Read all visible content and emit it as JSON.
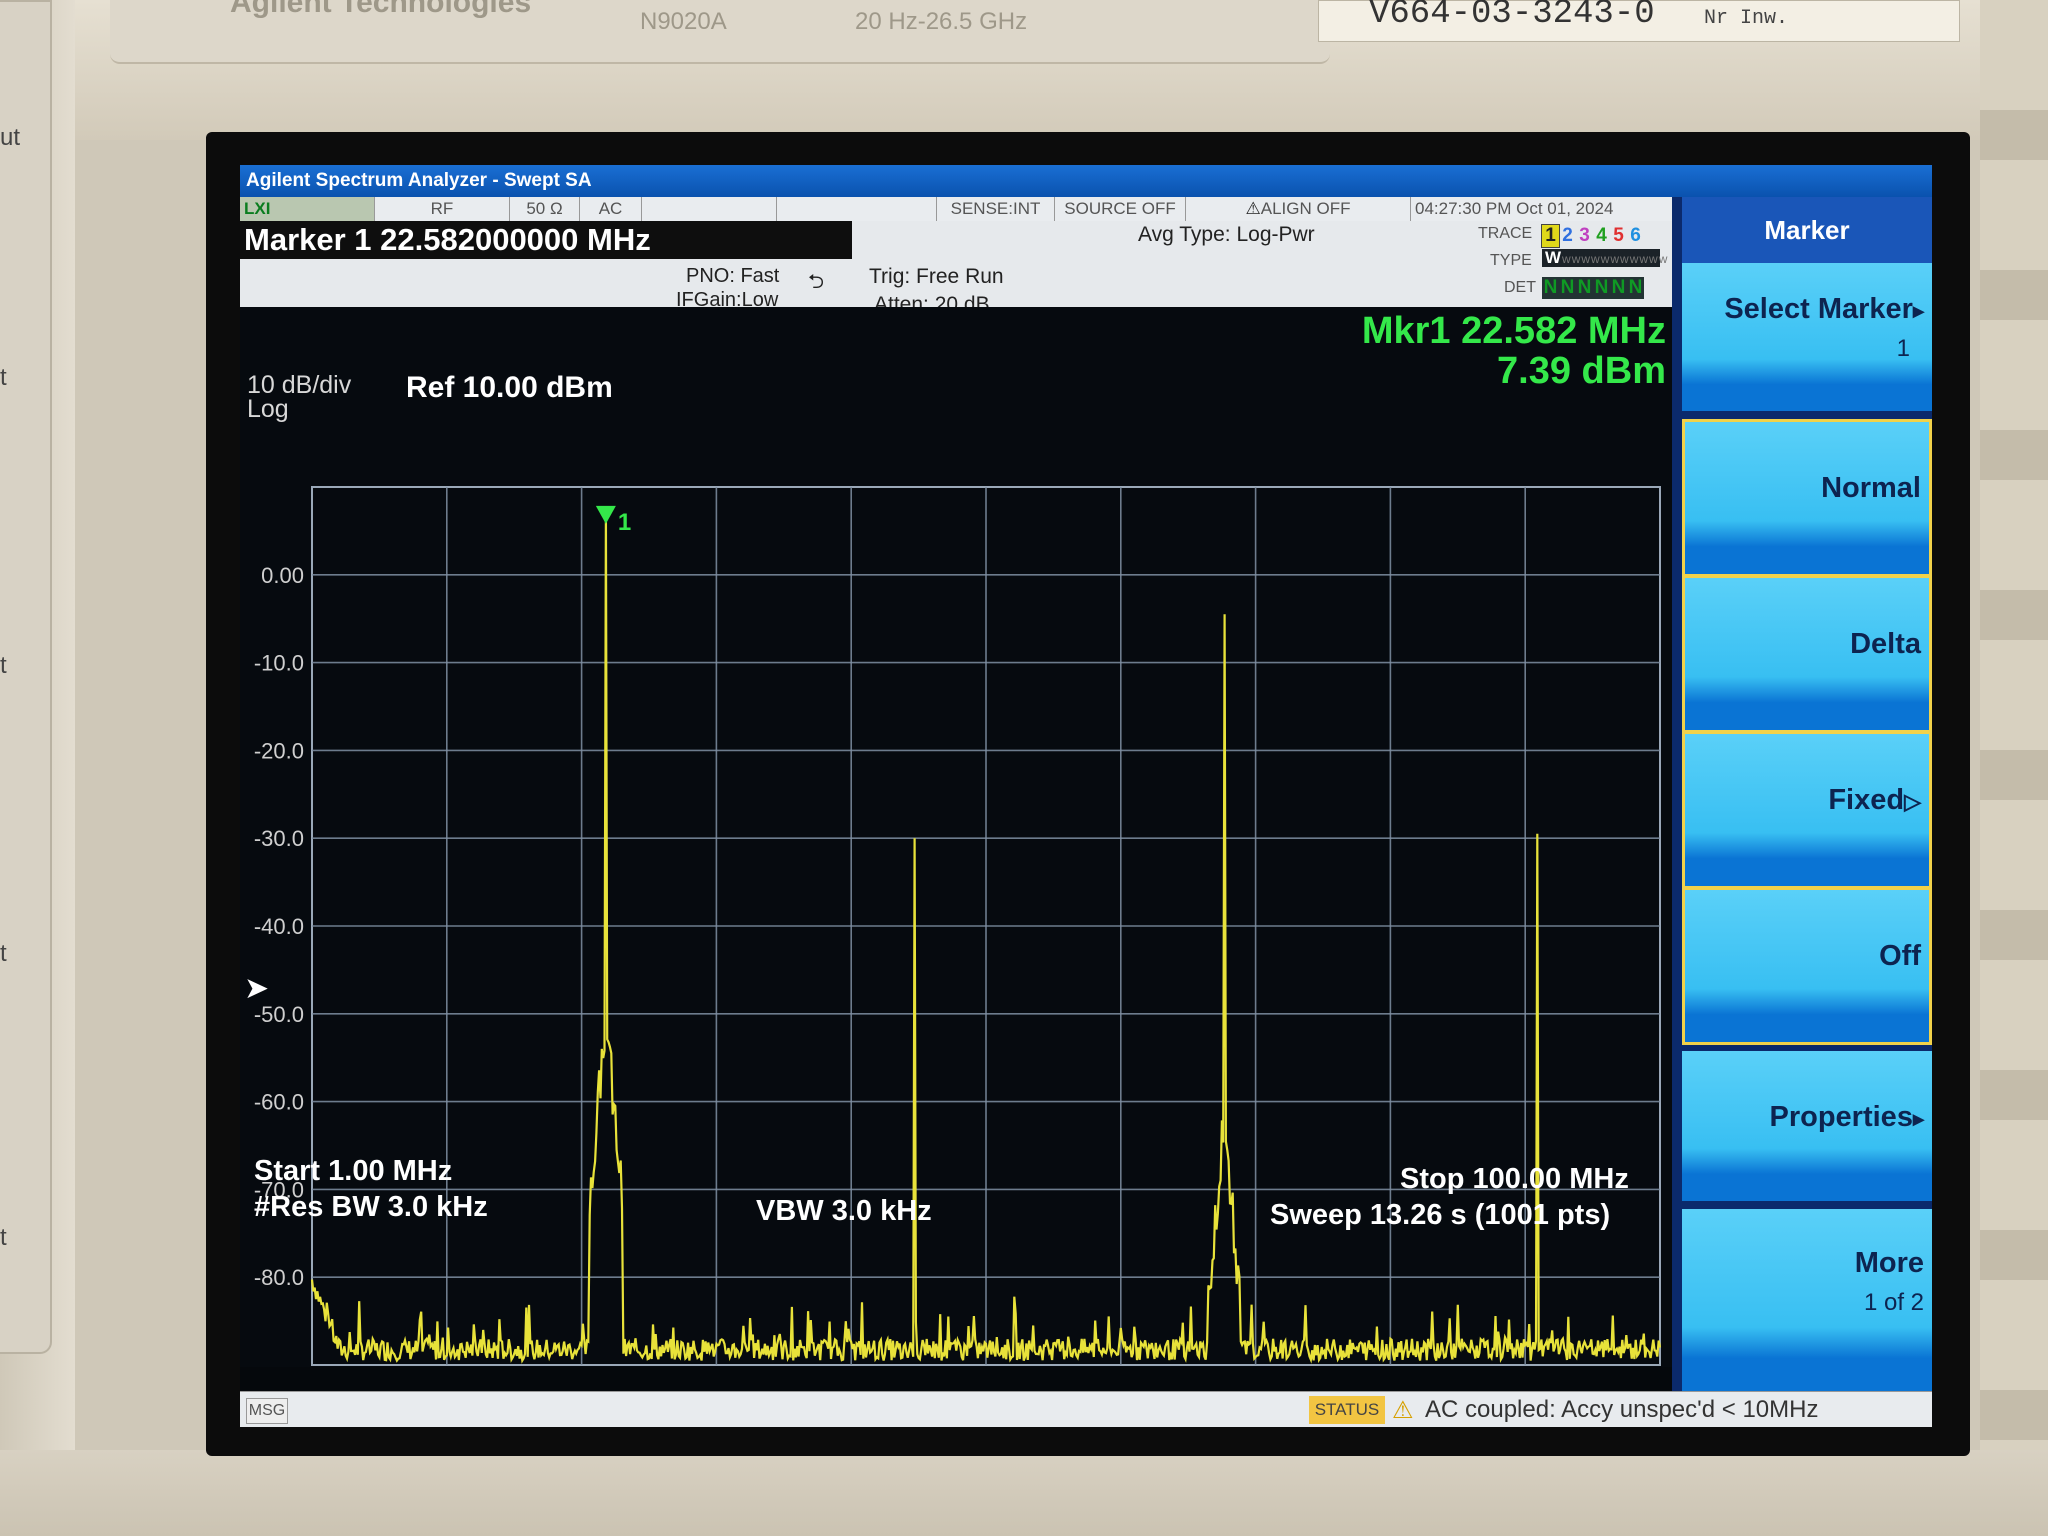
{
  "bezel": {
    "brand": "Agilent Technologies",
    "model": "N9020A",
    "freq_range": "20 Hz-26.5 GHz",
    "serial_label": "V664-03-3243-0",
    "serial_suffix": "Nr Inw.",
    "side_marks": [
      "ut",
      "t",
      "t",
      "t",
      "t"
    ]
  },
  "window": {
    "title": "Agilent Spectrum Analyzer - Swept SA"
  },
  "status_bar": {
    "lxi": "LXI",
    "rf": "RF",
    "impedance": "50 Ω",
    "coupling": "AC",
    "sense": "SENSE:INT",
    "source": "SOURCE OFF",
    "align": "ALIGN OFF",
    "datetime": "04:27:30 PM Oct 01, 2024"
  },
  "info": {
    "marker_readout": "Marker 1 22.582000000 MHz",
    "pno": "PNO: Fast",
    "ifgain": "IFGain:Low",
    "trig": "Trig: Free Run",
    "atten": "Atten: 20 dB",
    "avg_type": "Avg Type: Log-Pwr",
    "trace_label": "TRACE",
    "trace_numbers": [
      "1",
      "2",
      "3",
      "4",
      "5",
      "6"
    ],
    "trace_colors": [
      "#222222",
      "#3070e0",
      "#c040c0",
      "#20a020",
      "#e03030",
      "#2090e0"
    ],
    "type_label": "TYPE",
    "type_value": "W",
    "det_label": "DET",
    "det_values": [
      "N",
      "N",
      "N",
      "N",
      "N",
      "N"
    ]
  },
  "plot": {
    "scale": "10 dB/div",
    "scale_type": "Log",
    "ref_level": "Ref 10.00 dBm",
    "mkr_freq": "Mkr1 22.582 MHz",
    "mkr_ampl": "7.39 dBm",
    "marker_label": "1",
    "start": "Start 1.00 MHz",
    "res_bw": "#Res BW 3.0 kHz",
    "vbw": "VBW 3.0 kHz",
    "stop": "Stop 100.00 MHz",
    "sweep": "Sweep  13.26 s (1001 pts)"
  },
  "chart_data": {
    "type": "line",
    "title": "",
    "xlabel": "",
    "ylabel": "",
    "x_unit": "MHz",
    "y_unit": "dBm",
    "xlim": [
      1.0,
      100.0
    ],
    "ylim": [
      -90,
      10
    ],
    "grid": true,
    "y_ticks": [
      "0.00",
      "-10.0",
      "-20.0",
      "-30.0",
      "-40.0",
      "-50.0",
      "-60.0",
      "-70.0",
      "-80.0"
    ],
    "y_tick_values": [
      0,
      -10,
      -20,
      -30,
      -40,
      -50,
      -60,
      -70,
      -80
    ],
    "noise_floor_dbm": -87.5,
    "peaks": [
      {
        "freq_mhz": 22.58,
        "ampl_dbm": 7.39
      },
      {
        "freq_mhz": 45.3,
        "ampl_dbm": -30.0
      },
      {
        "freq_mhz": 68.0,
        "ampl_dbm": -4.5
      },
      {
        "freq_mhz": 91.0,
        "ampl_dbm": -29.5
      }
    ],
    "marker": {
      "freq_mhz": 22.582,
      "ampl_dbm": 7.39,
      "label": "1"
    },
    "trace_color": "#e8e23a"
  },
  "softkeys": {
    "menu_title": "Marker",
    "keys": [
      {
        "label": "Select Marker",
        "sub": "1",
        "arrow": "▸"
      },
      {
        "label": "Normal",
        "sub": "",
        "arrow": ""
      },
      {
        "label": "Delta",
        "sub": "",
        "arrow": ""
      },
      {
        "label": "Fixed",
        "sub": "",
        "arrow": "▷"
      },
      {
        "label": "Off",
        "sub": "",
        "arrow": ""
      },
      {
        "label": "Properties",
        "sub": "",
        "arrow": "▸"
      },
      {
        "label": "More",
        "sub": "1 of 2",
        "arrow": ""
      }
    ]
  },
  "message_bar": {
    "msg_label": "MSG",
    "status_label": "STATUS",
    "status_text": "AC coupled: Accy unspec'd < 10MHz"
  }
}
